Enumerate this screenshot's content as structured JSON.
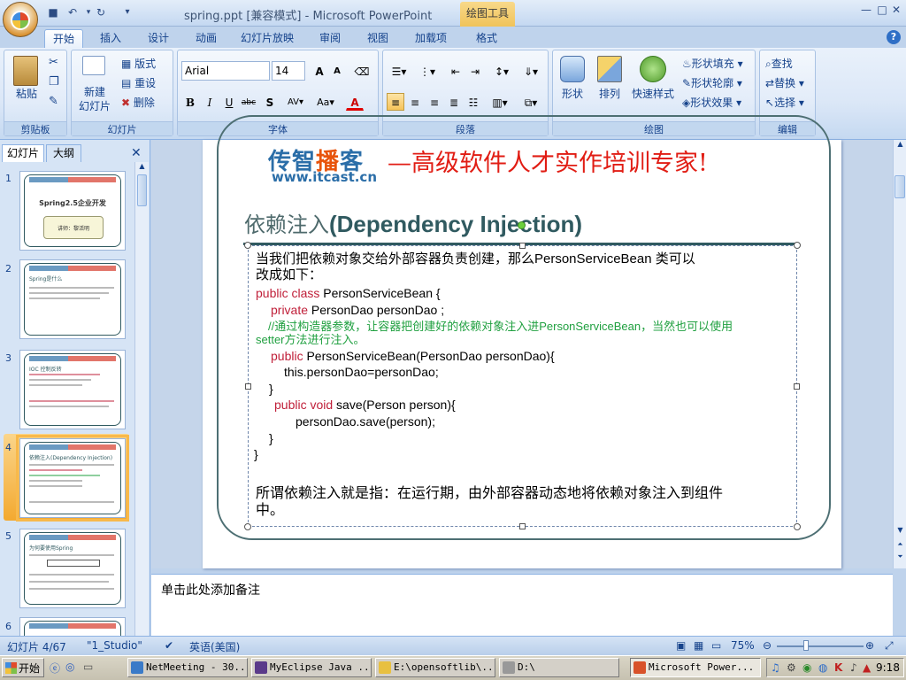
{
  "window": {
    "title": "spring.ppt [兼容模式] - Microsoft PowerPoint",
    "contextual_tab": "绘图工具",
    "controls": [
      "minimize",
      "maximize",
      "close"
    ]
  },
  "ribbon_tabs": [
    {
      "label": "开始",
      "active": true
    },
    {
      "label": "插入"
    },
    {
      "label": "设计"
    },
    {
      "label": "动画"
    },
    {
      "label": "幻灯片放映"
    },
    {
      "label": "审阅"
    },
    {
      "label": "视图"
    },
    {
      "label": "加载项"
    },
    {
      "label": "格式"
    }
  ],
  "ribbon": {
    "clipboard": {
      "paste": "粘贴",
      "group": "剪贴板"
    },
    "slides": {
      "new_slide_1": "新建",
      "new_slide_2": "幻灯片",
      "layout": "版式",
      "reset": "重设",
      "delete": "删除",
      "group": "幻灯片"
    },
    "font": {
      "name": "Arial",
      "size": "14",
      "group": "字体"
    },
    "paragraph": {
      "group": "段落"
    },
    "drawing": {
      "shape": "形状",
      "arrange": "排列",
      "quick_style": "快速样式",
      "fill": "形状填充",
      "outline": "形状轮廓",
      "effect": "形状效果",
      "group": "绘图"
    },
    "editing": {
      "find": "查找",
      "replace": "替换",
      "select": "选择",
      "group": "编辑"
    }
  },
  "left_panel": {
    "tab_slides": "幻灯片",
    "tab_outline": "大纲",
    "thumbnails": [
      {
        "num": "1",
        "title": "Spring2.5企业开发",
        "subtitle": "讲师：黎活明"
      },
      {
        "num": "2",
        "title": "Spring是什么"
      },
      {
        "num": "3",
        "title": "IOC 控制反转"
      },
      {
        "num": "4",
        "title": "依赖注入(Dependency Injection)",
        "selected": true
      },
      {
        "num": "5",
        "title": "为何要使用Spring"
      },
      {
        "num": "6",
        "title": ""
      }
    ]
  },
  "slide": {
    "brand_a": "传智",
    "brand_b": "播",
    "brand_c": "客",
    "brand_url": "www.itcast.cn",
    "slogan": "—高级软件人才实作培训专家!",
    "heading_cn": "依赖注入",
    "heading_en": "(Dependency Injection)",
    "lines": [
      "当我们把依赖对象交给外部容器负责创建，那么PersonServiceBean 类可以",
      "改成如下：",
      {
        "kw": "public class ",
        "rest": "PersonServiceBean {"
      },
      {
        "kw": "private ",
        "rest": "PersonDao personDao ;"
      },
      "//通过构造器参数，让容器把创建好的依赖对象注入进PersonServiceBean，当然也可以使用",
      "setter方法进行注入。",
      {
        "kw": "public ",
        "rest": "PersonServiceBean(PersonDao personDao){"
      },
      "this.personDao=personDao;",
      "}",
      {
        "kw": "public void ",
        "rest": "save(Person person){"
      },
      "personDao.save(person);",
      "}",
      "}",
      "所谓依赖注入就是指：在运行期，由外部容器动态地将依赖对象注入到组件",
      "中。"
    ]
  },
  "notes": {
    "placeholder": "单击此处添加备注"
  },
  "status": {
    "slide": "幻灯片 4/67",
    "theme": "\"1_Studio\"",
    "lang": "英语(美国)",
    "zoom": "75%"
  },
  "taskbar": {
    "start": "开始",
    "items": [
      "NetMeeting - 30...",
      "MyEclipse Java ...",
      "E:\\opensoftlib\\...",
      "D:\\",
      "Microsoft Power..."
    ],
    "clock": "9:18"
  },
  "colors": {
    "accent": "#2b6ea8",
    "slogan": "#e11d14",
    "keyword": "#c0203a",
    "comment": "#20a040",
    "frame": "#305a60"
  }
}
